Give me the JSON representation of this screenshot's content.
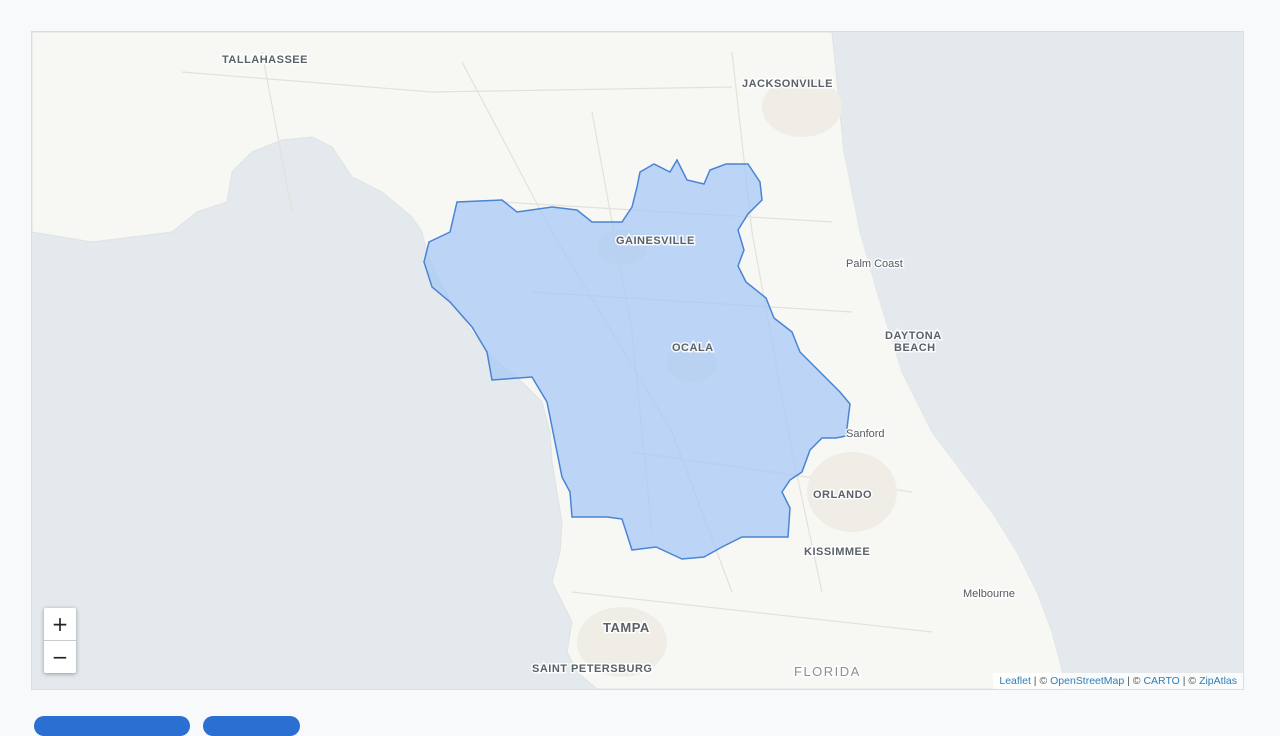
{
  "map": {
    "place_labels": {
      "tallahassee": "TALLAHASSEE",
      "jacksonville": "JACKSONVILLE",
      "gainesville": "GAINESVILLE",
      "palm_coast": "Palm Coast",
      "daytona_line1": "DAYTONA",
      "daytona_line2": "BEACH",
      "ocala": "OCALA",
      "sanford": "Sanford",
      "orlando": "ORLANDO",
      "kissimmee": "KISSIMMEE",
      "melbourne": "Melbourne",
      "tampa": "TAMPA",
      "saint_petersburg": "SAINT PETERSBURG",
      "florida": "FLORIDA"
    },
    "highlight_color": "#a8c8f5",
    "highlight_border": "#4a84d4",
    "land_color": "#f7f7f4",
    "water_color": "#e3e9ec"
  },
  "zoom": {
    "in_label": "+",
    "out_label": "−"
  },
  "attribution": {
    "leaflet": "Leaflet",
    "sep1": " | © ",
    "osm": "OpenStreetMap",
    "sep2": " | © ",
    "carto": "CARTO",
    "sep3": " | © ",
    "zipatlas": "ZipAtlas"
  }
}
